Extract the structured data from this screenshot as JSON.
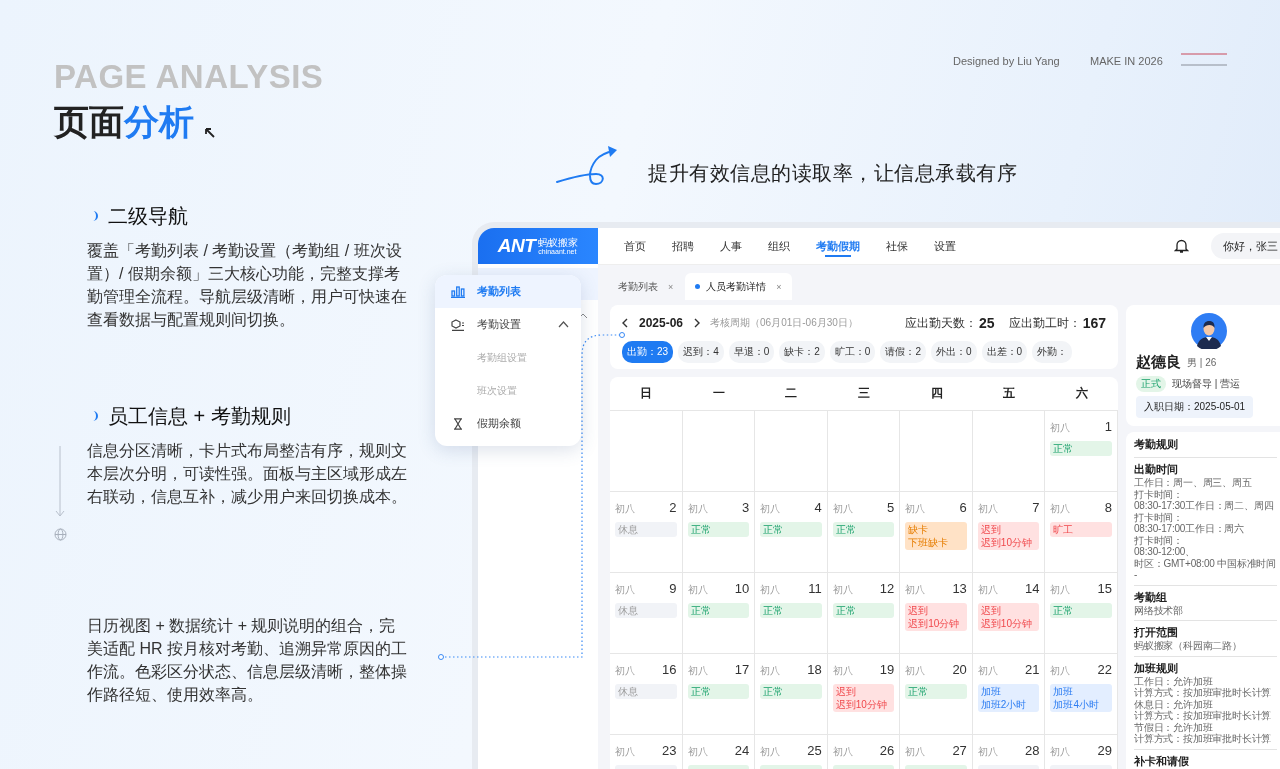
{
  "slide": {
    "eyebrow": "PAGE ANALYSIS",
    "title": "页面",
    "title_accent": "分析",
    "credit": "Designed by Liu Yang",
    "year_note": "MAKE IN 2026",
    "headline": "提升有效信息的读取率，让信息承载有序"
  },
  "sections": [
    {
      "heading": "二级导航",
      "text": "覆盖「考勤列表 / 考勤设置（考勤组 / 班次设置）/ 假期余额」三大核心功能，完整支撑考勤管理全流程。导航层级清晰，用户可快速在查看数据与配置规则间切换。"
    },
    {
      "heading": "员工信息 + 考勤规则",
      "text": "信息分区清晰，卡片式布局整洁有序，规则文本层次分明，可读性强。面板与主区域形成左右联动，信息互补，减少用户来回切换成本。"
    },
    {
      "text": "日历视图 + 数据统计 + 规则说明的组合，完美适配 HR 按月核对考勤、追溯异常原因的工作流。色彩区分状态、信息层级清晰，整体操作路径短、使用效率高。"
    }
  ],
  "app": {
    "logo": {
      "mark": "ANT",
      "name": "蚂蚁搬家",
      "domain": "chinaant.net"
    },
    "nav": [
      {
        "label": "首页",
        "selected": false
      },
      {
        "label": "招聘",
        "selected": false
      },
      {
        "label": "人事",
        "selected": false
      },
      {
        "label": "组织",
        "selected": false
      },
      {
        "label": "考勤假期",
        "selected": true
      },
      {
        "label": "社保",
        "selected": false
      },
      {
        "label": "设置",
        "selected": false
      }
    ],
    "greeting": "你好，张三",
    "tabs": [
      {
        "label": "考勤列表",
        "selected": false,
        "close": "×"
      },
      {
        "label": "人员考勤详情",
        "selected": true,
        "close": "×"
      }
    ],
    "menu": [
      {
        "label": "考勤列表",
        "kind": "chart",
        "selected": true
      },
      {
        "label": "考勤设置",
        "kind": "settings",
        "selected": false,
        "expanded": true,
        "children": [
          {
            "label": "考勤组设置"
          },
          {
            "label": "班次设置"
          }
        ]
      },
      {
        "label": "假期余额",
        "kind": "hourglass",
        "selected": false
      }
    ],
    "summary": {
      "month": "2025-06",
      "period": "考核周期（06月01日-06月30日）",
      "days_label": "应出勤天数：",
      "days": "25",
      "hours_label": "应出勤工时：",
      "hours": "167"
    },
    "stats": [
      {
        "label": "出勤：23",
        "selected": true
      },
      {
        "label": "迟到：4",
        "selected": false
      },
      {
        "label": "早退：0",
        "selected": false
      },
      {
        "label": "缺卡：2",
        "selected": false
      },
      {
        "label": "旷工：0",
        "selected": false
      },
      {
        "label": "请假：2",
        "selected": false
      },
      {
        "label": "外出：0",
        "selected": false
      },
      {
        "label": "出差：0",
        "selected": false
      },
      {
        "label": "外勤：",
        "selected": false
      }
    ],
    "weekdays": [
      "日",
      "一",
      "二",
      "三",
      "四",
      "五",
      "六"
    ],
    "weeks": [
      [
        {
          "kind": "blank"
        },
        {
          "kind": "blank"
        },
        {
          "kind": "blank"
        },
        {
          "kind": "blank"
        },
        {
          "kind": "blank"
        },
        {
          "kind": "blank"
        },
        {
          "lunar": "初八",
          "day": "1",
          "tag": {
            "kind": "normal",
            "label": "正常"
          }
        }
      ],
      [
        {
          "lunar": "初八",
          "day": "2",
          "tag": {
            "kind": "rest",
            "label": "休息"
          }
        },
        {
          "lunar": "初八",
          "day": "3",
          "tag": {
            "kind": "normal",
            "label": "正常"
          }
        },
        {
          "lunar": "初八",
          "day": "4",
          "tag": {
            "kind": "normal",
            "label": "正常"
          }
        },
        {
          "lunar": "初八",
          "day": "5",
          "tag": {
            "kind": "normal",
            "label": "正常"
          }
        },
        {
          "lunar": "初八",
          "day": "6",
          "tag": {
            "kind": "missing",
            "label": "缺卡",
            "note": "下班缺卡"
          }
        },
        {
          "lunar": "初八",
          "day": "7",
          "tag": {
            "kind": "late",
            "label": "迟到",
            "note": "迟到10分钟"
          }
        },
        {
          "lunar": "初八",
          "day": "8",
          "tag": {
            "kind": "absent",
            "label": "旷工"
          }
        }
      ],
      [
        {
          "lunar": "初八",
          "day": "9",
          "tag": {
            "kind": "rest",
            "label": "休息"
          }
        },
        {
          "lunar": "初八",
          "day": "10",
          "tag": {
            "kind": "normal",
            "label": "正常"
          }
        },
        {
          "lunar": "初八",
          "day": "11",
          "tag": {
            "kind": "normal",
            "label": "正常"
          }
        },
        {
          "lunar": "初八",
          "day": "12",
          "tag": {
            "kind": "normal",
            "label": "正常"
          }
        },
        {
          "lunar": "初八",
          "day": "13",
          "tag": {
            "kind": "late",
            "label": "迟到",
            "note": "迟到10分钟"
          }
        },
        {
          "lunar": "初八",
          "day": "14",
          "tag": {
            "kind": "late",
            "label": "迟到",
            "note": "迟到10分钟"
          }
        },
        {
          "lunar": "初八",
          "day": "15",
          "tag": {
            "kind": "normal",
            "label": "正常"
          }
        }
      ],
      [
        {
          "lunar": "初八",
          "day": "16",
          "tag": {
            "kind": "rest",
            "label": "休息"
          }
        },
        {
          "lunar": "初八",
          "day": "17",
          "tag": {
            "kind": "normal",
            "label": "正常"
          }
        },
        {
          "lunar": "初八",
          "day": "18",
          "tag": {
            "kind": "normal",
            "label": "正常"
          }
        },
        {
          "lunar": "初八",
          "day": "19",
          "tag": {
            "kind": "late",
            "label": "迟到",
            "note": "迟到10分钟"
          }
        },
        {
          "lunar": "初八",
          "day": "20",
          "tag": {
            "kind": "normal",
            "label": "正常"
          }
        },
        {
          "lunar": "初八",
          "day": "21",
          "tag": {
            "kind": "overtime",
            "label": "加班",
            "note": "加班2小时"
          }
        },
        {
          "lunar": "初八",
          "day": "22",
          "tag": {
            "kind": "overtime",
            "label": "加班",
            "note": "加班4小时"
          }
        }
      ],
      [
        {
          "lunar": "初八",
          "day": "23",
          "tag": {
            "kind": "rest"
          }
        },
        {
          "lunar": "初八",
          "day": "24",
          "tag": {
            "kind": "normal"
          }
        },
        {
          "lunar": "初八",
          "day": "25",
          "tag": {
            "kind": "normal"
          }
        },
        {
          "lunar": "初八",
          "day": "26",
          "tag": {
            "kind": "normal"
          }
        },
        {
          "lunar": "初八",
          "day": "27",
          "tag": {
            "kind": "normal"
          }
        },
        {
          "lunar": "初八",
          "day": "28",
          "tag": {
            "kind": "rest"
          }
        },
        {
          "lunar": "初八",
          "day": "29",
          "tag": {
            "kind": "rest"
          }
        }
      ]
    ],
    "profile": {
      "name": "赵德良",
      "meta": "男 | 26",
      "status": "正式",
      "position": "现场督导 | 营运",
      "join_date": "入职日期：2025-05-01"
    },
    "rules": {
      "title": "考勤规则",
      "sections": [
        {
          "heading": "出勤时间",
          "lines": [
            "工作日：周一、周三、周五",
            "打卡时间：",
            "08:30-17:30工作日：周二、周四",
            "打卡时间：",
            "08:30-17:00工作日：周六",
            "打卡时间：",
            "08:30-12:00、",
            "时区：GMT+08:00 中国标准时间 -"
          ]
        },
        {
          "heading": "考勤组",
          "lines": [
            "网络技术部"
          ]
        },
        {
          "heading": "打开范围",
          "lines": [
            "蚂蚁搬家（科园南二路）"
          ]
        },
        {
          "heading": "加班规则",
          "lines": [
            "工作日：允许加班",
            "计算方式：按加班审批时长计算",
            "休息日：允许加班",
            "计算方式：按加班审批时长计算",
            "节假日：允许加班",
            "计算方式：按加班审批时长计算"
          ]
        },
        {
          "heading": "补卡和请假"
        }
      ]
    }
  }
}
